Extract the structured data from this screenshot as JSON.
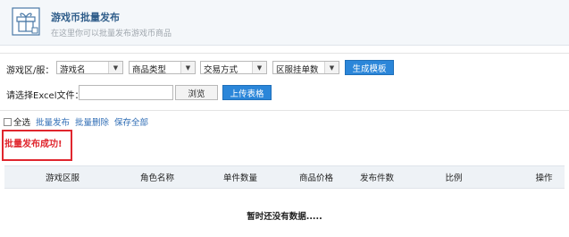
{
  "header": {
    "title": "游戏币批量发布",
    "subtitle": "在这里你可以批量发布游戏币商品",
    "icon": "gift-box-icon"
  },
  "filters": {
    "region_label": "游戏区/服：",
    "game_select": "游戏名",
    "type_select": "商品类型",
    "trade_select": "交易方式",
    "count_select": "区服挂单数",
    "generate_button": "生成模板",
    "excel_label": "请选择Excel文件：",
    "file_value": "",
    "browse_button": "浏览",
    "upload_button": "上传表格"
  },
  "actions": {
    "select_all": "全选",
    "batch_publish": "批量发布",
    "batch_delete": "批量删除",
    "save_all": "保存全部"
  },
  "message": "批量发布成功!",
  "table": {
    "columns": [
      "游戏区服",
      "角色名称",
      "单件数量",
      "商品价格",
      "发布件数",
      "比例",
      "操作"
    ],
    "empty_text": "暂时还没有数据....."
  },
  "colors": {
    "accent": "#2b86d9",
    "error": "#e0262e",
    "link": "#2f6db5",
    "header_bg": "#f4f7fa"
  }
}
